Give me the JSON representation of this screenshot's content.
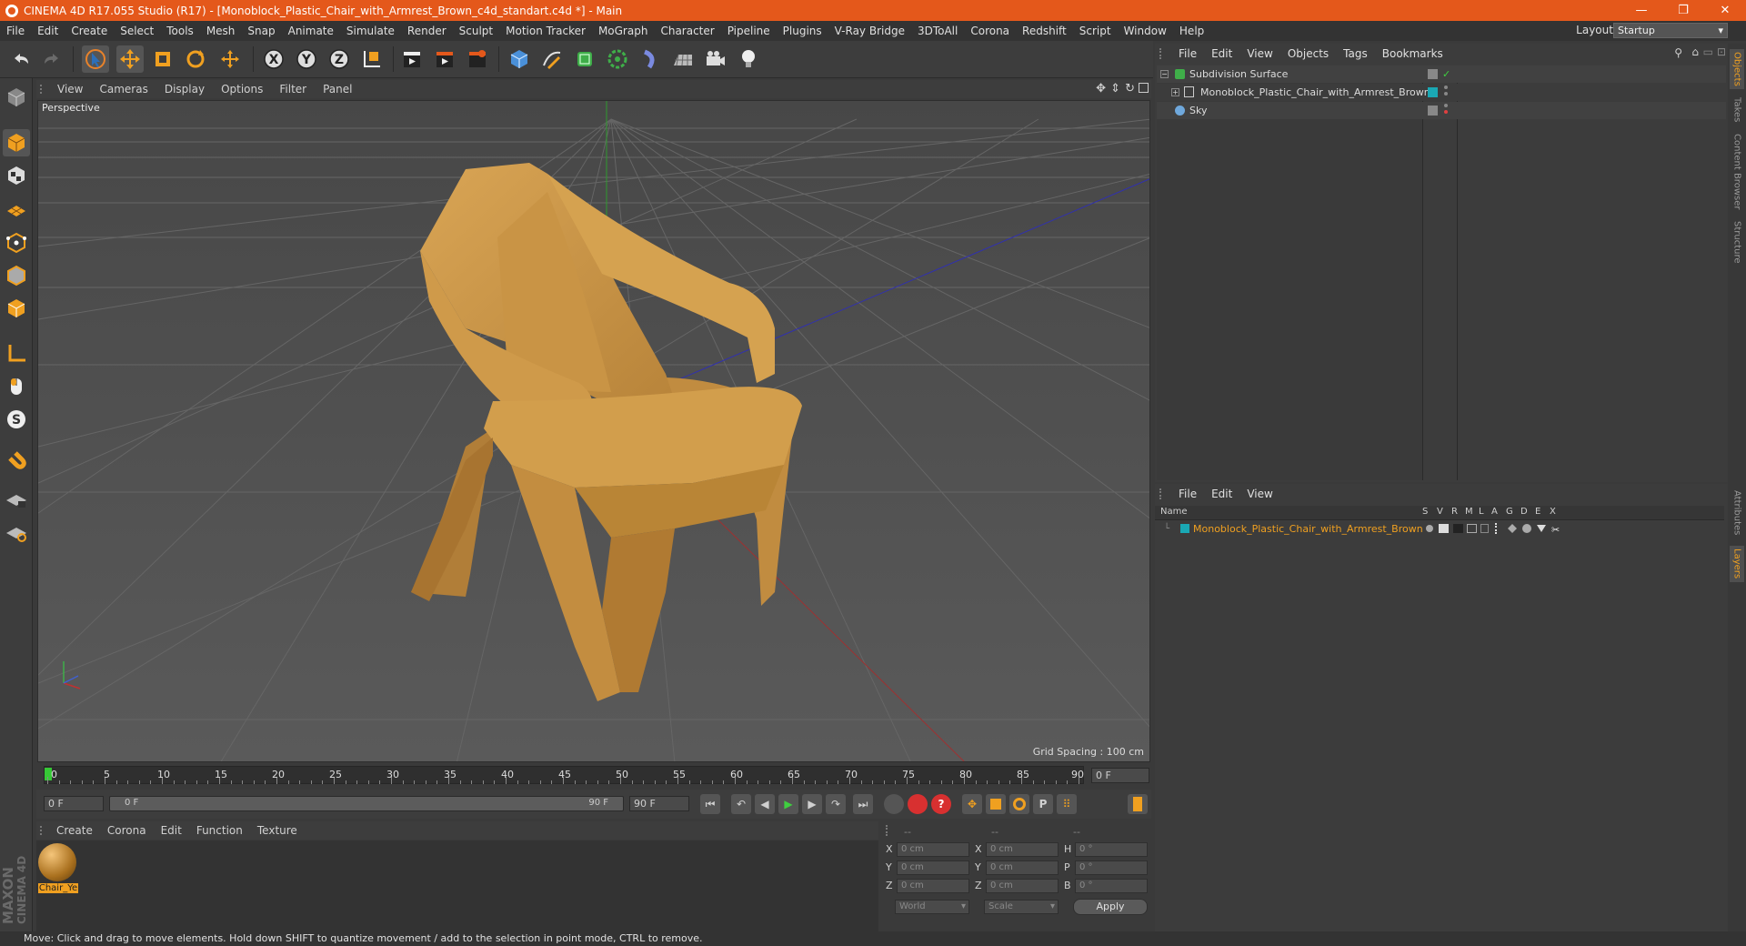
{
  "window": {
    "title": "CINEMA 4D R17.055 Studio (R17) - [Monoblock_Plastic_Chair_with_Armrest_Brown_c4d_standart.c4d *] - Main",
    "minimize": "—",
    "maximize": "❐",
    "close": "✕"
  },
  "menubar": {
    "items": [
      "File",
      "Edit",
      "Create",
      "Select",
      "Tools",
      "Mesh",
      "Snap",
      "Animate",
      "Simulate",
      "Render",
      "Sculpt",
      "Motion Tracker",
      "MoGraph",
      "Character",
      "Pipeline",
      "Plugins",
      "V-Ray Bridge",
      "3DToAll",
      "Corona",
      "Redshift",
      "Script",
      "Window",
      "Help"
    ],
    "layout_label": "Layout:",
    "layout_value": "Startup"
  },
  "viewport": {
    "menu": [
      "View",
      "Cameras",
      "Display",
      "Options",
      "Filter",
      "Panel"
    ],
    "label": "Perspective",
    "grid_spacing": "Grid Spacing : 100 cm"
  },
  "timeline": {
    "ticks": [
      "0",
      "5",
      "10",
      "15",
      "20",
      "25",
      "30",
      "35",
      "40",
      "45",
      "50",
      "55",
      "60",
      "65",
      "70",
      "75",
      "80",
      "85",
      "90"
    ],
    "current_frame": "0 F",
    "start_field": "0 F",
    "range_start": "0 F",
    "range_end": "90 F",
    "end_field": "90 F"
  },
  "material_panel": {
    "menu": [
      "Create",
      "Corona",
      "Edit",
      "Function",
      "Texture"
    ],
    "material_name": "Chair_Ye"
  },
  "coordinates": {
    "headers": [
      "--",
      "--",
      "--"
    ],
    "rows": [
      {
        "l1": "X",
        "v1": "0 cm",
        "l2": "X",
        "v2": "0 cm",
        "l3": "H",
        "v3": "0 °"
      },
      {
        "l1": "Y",
        "v1": "0 cm",
        "l2": "Y",
        "v2": "0 cm",
        "l3": "P",
        "v3": "0 °"
      },
      {
        "l1": "Z",
        "v1": "0 cm",
        "l2": "Z",
        "v2": "0 cm",
        "l3": "B",
        "v3": "0 °"
      }
    ],
    "mode": "World",
    "scale": "Scale",
    "apply": "Apply"
  },
  "object_manager": {
    "menu": [
      "File",
      "Edit",
      "View",
      "Objects",
      "Tags",
      "Bookmarks"
    ],
    "objects": [
      {
        "name": "Subdivision Surface"
      },
      {
        "name": "Monoblock_Plastic_Chair_with_Armrest_Brown"
      },
      {
        "name": "Sky"
      }
    ]
  },
  "layer_manager": {
    "menu": [
      "File",
      "Edit",
      "View"
    ],
    "col_name": "Name",
    "col_flags": [
      "S",
      "V",
      "R",
      "M",
      "L",
      "A",
      "G",
      "D",
      "E",
      "X"
    ],
    "layers": [
      {
        "name": "Monoblock_Plastic_Chair_with_Armrest_Brown"
      }
    ]
  },
  "side_tabs": [
    "Objects",
    "Takes",
    "Content Browser",
    "Structure",
    "Attributes",
    "Layers"
  ],
  "status": "Move: Click and drag to move elements. Hold down SHIFT to quantize movement / add to the selection in point mode, CTRL to remove.",
  "branding": {
    "line1": "MAXON",
    "line2": "CINEMA 4D"
  },
  "colors": {
    "accent": "#e4581b",
    "layer_teal": "#1aa8b4",
    "selected_text": "#f0a020"
  }
}
